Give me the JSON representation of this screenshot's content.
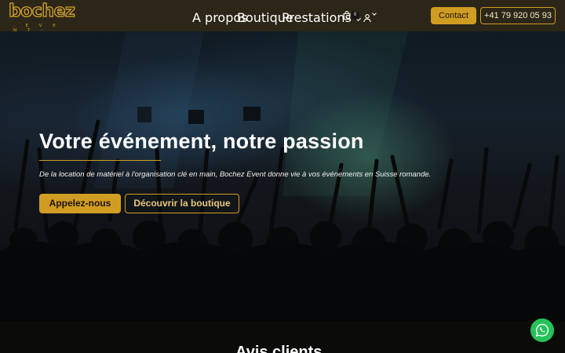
{
  "brand": {
    "logo_text": "bochez",
    "logo_subtext": "· E V E N T ·",
    "accent_color": "#d19c22"
  },
  "nav": {
    "items": [
      {
        "label": "A propos",
        "has_dropdown": false
      },
      {
        "label": "Boutique",
        "has_dropdown": false
      },
      {
        "label": "Prestations",
        "has_dropdown": true
      }
    ],
    "cart_count": "0",
    "cart_icon": "shopping-bag-icon",
    "account_icon": "user-icon"
  },
  "header_actions": {
    "contact_label": "Contact",
    "phone_label": "+41 79 920 05 93"
  },
  "hero": {
    "title": "Votre événement, notre passion",
    "subtitle": "De la location de matériel à l'organisation clé en main, Bochez Event donne vie à vos événements en Suisse romande.",
    "primary_button": "Appelez-nous",
    "secondary_button": "Découvrir la boutique"
  },
  "next_section": {
    "title": "Avis clients"
  },
  "floating": {
    "chat_icon": "whatsapp-icon",
    "chat_color": "#25c25a"
  }
}
